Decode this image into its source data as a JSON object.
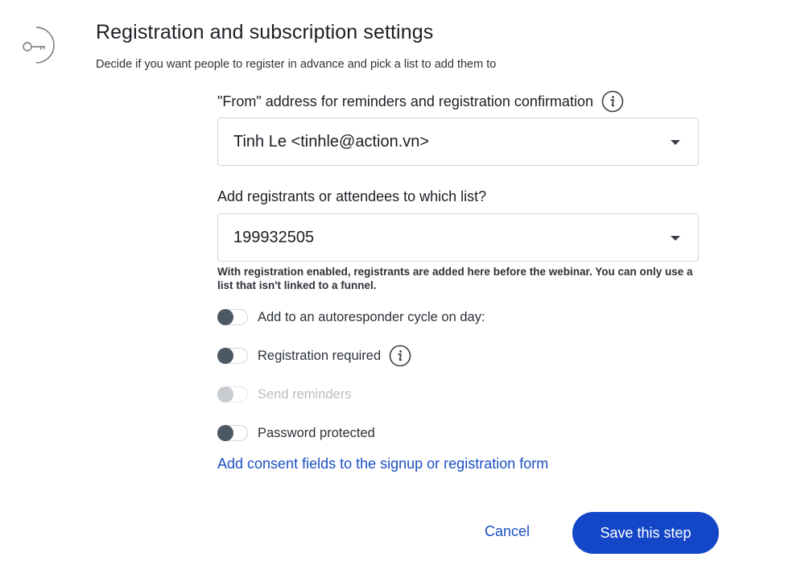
{
  "header": {
    "title": "Registration and subscription settings",
    "subtitle": "Decide if you want people to register in advance and pick a list to add them to",
    "icon": "key-icon"
  },
  "from_address": {
    "label": "\"From\" address for reminders and registration confirmation",
    "value": "Tinh Le <tinhle@action.vn>",
    "info_icon": "info-icon"
  },
  "list": {
    "label": "Add registrants or attendees to which list?",
    "value": "199932505",
    "helper": "With registration enabled, registrants are added here before the webinar. You can only use a list that isn't linked to a funnel."
  },
  "toggles": [
    {
      "label": "Add to an autoresponder cycle on day:",
      "on": false,
      "disabled": false
    },
    {
      "label": "Registration required",
      "on": false,
      "disabled": false,
      "has_info": true
    },
    {
      "label": "Send reminders",
      "on": false,
      "disabled": true
    },
    {
      "label": "Password protected",
      "on": false,
      "disabled": false
    }
  ],
  "consent_link": "Add consent fields to the signup or registration form",
  "actions": {
    "cancel": "Cancel",
    "save": "Save this step"
  },
  "colors": {
    "accent": "#1447c8",
    "link": "#1a4fc4",
    "toggle_knob": "#4d5865",
    "toggle_knob_disabled": "#c9ccd0"
  }
}
